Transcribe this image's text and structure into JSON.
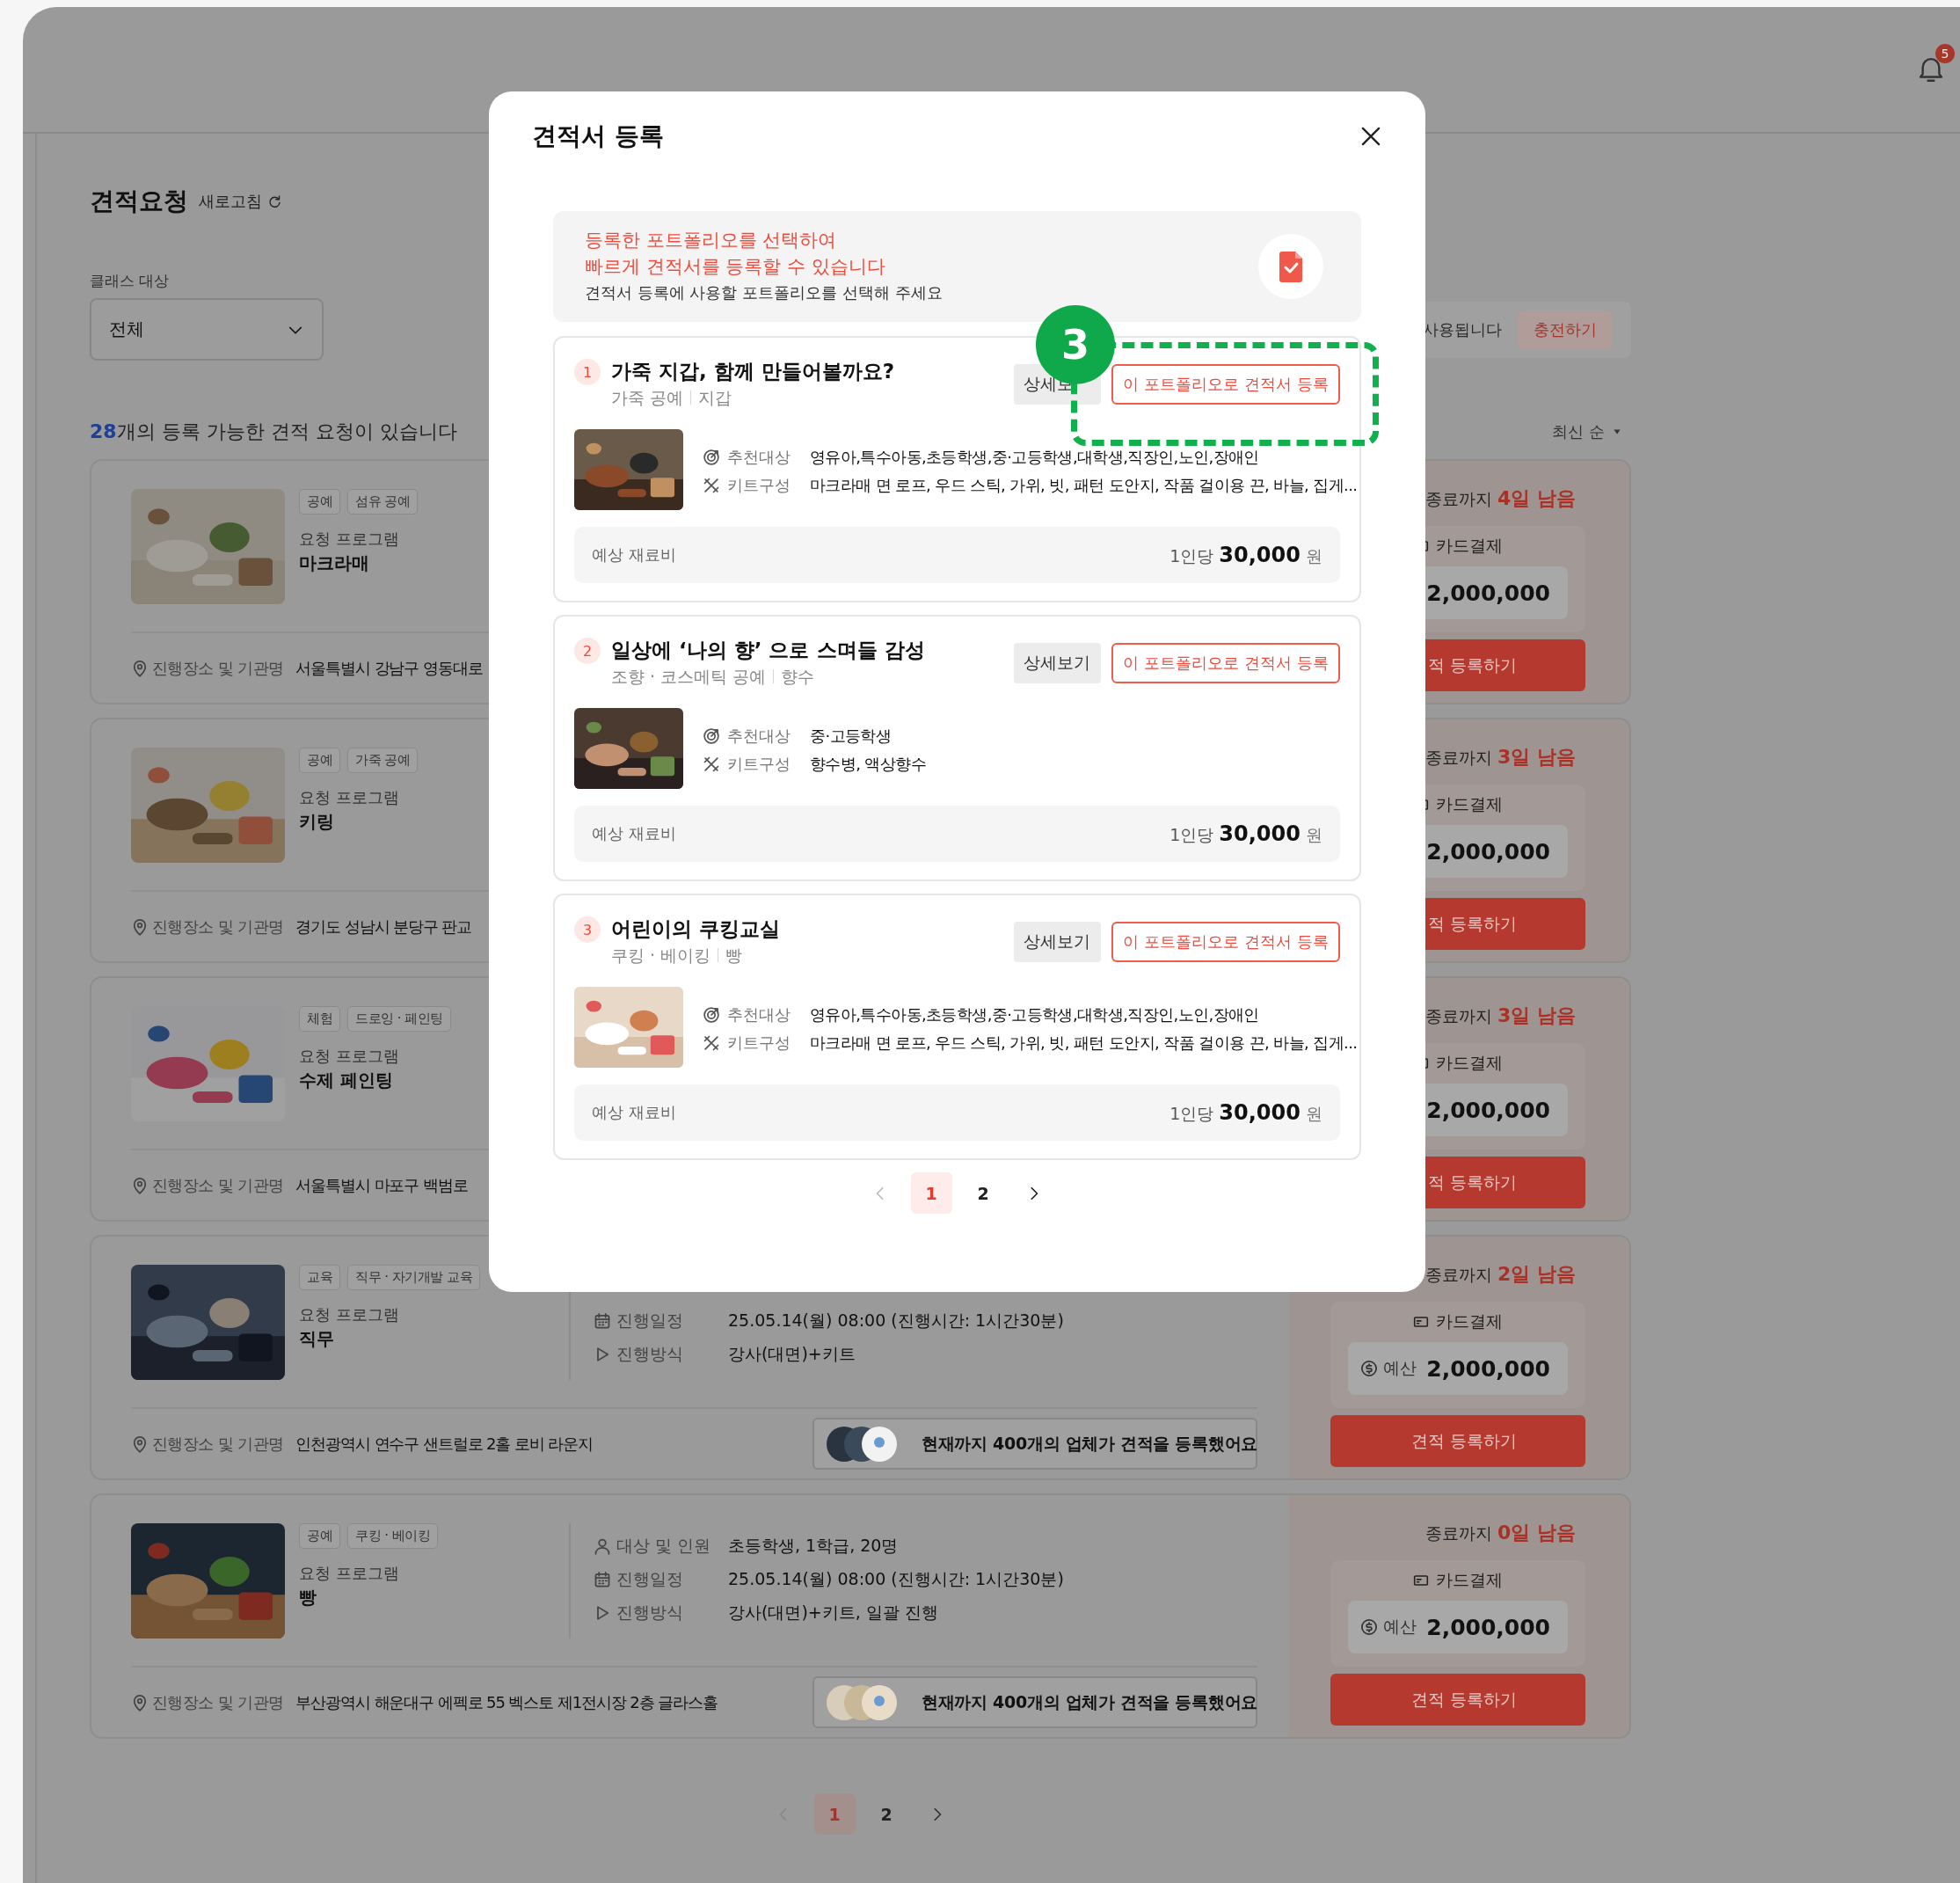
{
  "header": {
    "notification_count": "5"
  },
  "page": {
    "title": "견적요청",
    "refresh": "새로고침",
    "filter": {
      "label": "클래스 대상",
      "value": "전체"
    },
    "banner": {
      "text": "사용됩니다",
      "button": "충전하기"
    },
    "count": "28",
    "count_text": "개의 등록 가능한 견적 요청이 있습니다",
    "sort": "최신 순"
  },
  "requests": [
    {
      "tags": [
        "공예",
        "섬유 공예"
      ],
      "program_label": "요청 프로그램",
      "program": "마크라매",
      "location_label": "진행장소 및 기관명",
      "location": "서울특별시 강남구 영동대로",
      "deadline": "종료까지",
      "days_left": "4일 남음",
      "payment": "카드결제",
      "budget": "2,000,000",
      "button": "적 등록하기"
    },
    {
      "tags": [
        "공예",
        "가죽 공예"
      ],
      "program_label": "요청 프로그램",
      "program": "키링",
      "location_label": "진행장소 및 기관명",
      "location": "경기도 성남시 분당구 판교",
      "deadline": "종료까지",
      "days_left": "3일 남음",
      "payment": "카드결제",
      "budget": "2,000,000",
      "button": "적 등록하기"
    },
    {
      "tags": [
        "체험",
        "드로잉 · 페인팅"
      ],
      "program_label": "요청 프로그램",
      "program": "수제 페인팅",
      "location_label": "진행장소 및 기관명",
      "location": "서울특별시 마포구 백범로",
      "deadline": "종료까지",
      "days_left": "3일 남음",
      "payment": "카드결제",
      "budget": "2,000,000",
      "button": "적 등록하기"
    },
    {
      "tags": [
        "교육",
        "직무 · 자기개발 교육"
      ],
      "program_label": "요청 프로그램",
      "program": "직무",
      "details": [
        {
          "kind": "schedule",
          "label": "진행일정",
          "value": "25.05.14(월) 08:00 (진행시간: 1시간30분)"
        },
        {
          "kind": "method",
          "label": "진행방식",
          "value": "강사(대면)+키트"
        }
      ],
      "location_label": "진행장소 및 기관명",
      "location": "인천광역시 연수구 샌트럴로 2홀 로비 라운지",
      "registrations": "현재까지 400개의 업체가 견적을 등록했어요",
      "deadline": "종료까지",
      "days_left": "2일 남음",
      "payment": "카드결제",
      "budget_label": "예산",
      "budget": "2,000,000",
      "button": "견적 등록하기"
    },
    {
      "tags": [
        "공예",
        "쿠킹 · 베이킹"
      ],
      "program_label": "요청 프로그램",
      "program": "빵",
      "details": [
        {
          "kind": "audience",
          "label": "대상 및 인원",
          "value": "초등학생,  1학급, 20명"
        },
        {
          "kind": "schedule",
          "label": "진행일정",
          "value": "25.05.14(월) 08:00 (진행시간: 1시간30분)"
        },
        {
          "kind": "method",
          "label": "진행방식",
          "value": "강사(대면)+키트, 일괄 진행"
        }
      ],
      "location_label": "진행장소 및 기관명",
      "location": "부산광역시 해운대구 에펙로 55 벡스토 제1전시장 2층 글라스홀",
      "registrations": "현재까지 400개의 업체가 견적을 등록했어요",
      "deadline": "종료까지",
      "days_left": "0일 남음",
      "payment": "카드결제",
      "budget_label": "예산",
      "budget": "2,000,000",
      "button": "견적 등록하기"
    }
  ],
  "pagination": {
    "prev": {
      "disabled": true
    },
    "pages": [
      {
        "label": "1",
        "selected": true
      },
      {
        "label": "2",
        "selected": false
      }
    ],
    "next": {
      "disabled": false
    }
  },
  "modal": {
    "title": "견적서 등록",
    "notice": {
      "lines": [
        "등록한 포트폴리오를 선택하여",
        "빠르게 견적서를 등록할 수 있습니다"
      ],
      "hint": "견적서 등록에 사용할 포트폴리오를 선택해 주세요"
    },
    "portfolios": [
      {
        "number": "1",
        "title": "가죽 지갑, 함께 만들어볼까요?",
        "category": "가죽 공예",
        "subcategory": "지갑",
        "detail_button": "상세보",
        "select_button": "이 포트폴리오로 견적서 등록",
        "target_label": "추천대상",
        "target": "영유아,특수아동,초등학생,중·고등학생,대학생,직장인,노인,장애인",
        "kit_label": "키트구성",
        "kit": "마크라매 면 로프, 우드 스틱, 가위, 빗, 패턴 도안지, 작품 걸이용 끈, 바늘, 집게...",
        "cost_label": "예상 재료비",
        "price_prefix": "1인당",
        "price": "30,000",
        "unit": "원"
      },
      {
        "number": "2",
        "title": "일상에 ‘나의 향’ 으로 스며들 감성",
        "category": "조향 · 코스메틱 공예",
        "subcategory": "향수",
        "detail_button": "상세보기",
        "select_button": "이 포트폴리오로 견적서 등록",
        "target_label": "추천대상",
        "target": "중·고등학생",
        "kit_label": "키트구성",
        "kit": "향수병, 액상향수",
        "cost_label": "예상 재료비",
        "price_prefix": "1인당",
        "price": "30,000",
        "unit": "원"
      },
      {
        "number": "3",
        "title": "어린이의 쿠킹교실",
        "category": "쿠킹 · 베이킹",
        "subcategory": "빵",
        "detail_button": "상세보기",
        "select_button": "이 포트폴리오로 견적서 등록",
        "target_label": "추천대상",
        "target": "영유아,특수아동,초등학생,중·고등학생,대학생,직장인,노인,장애인",
        "kit_label": "키트구성",
        "kit": "마크라매 면 로프, 우드 스틱, 가위, 빗, 패턴 도안지, 작품 걸이용 끈, 바늘, 집게...",
        "cost_label": "예상 재료비",
        "price_prefix": "1인당",
        "price": "30,000",
        "unit": "원"
      }
    ],
    "pagination": {
      "prev": {
        "disabled": true
      },
      "pages": [
        {
          "label": "1",
          "selected": true
        },
        {
          "label": "2",
          "selected": false
        }
      ],
      "next": {
        "disabled": false
      }
    }
  },
  "annotation": {
    "label": "3"
  }
}
